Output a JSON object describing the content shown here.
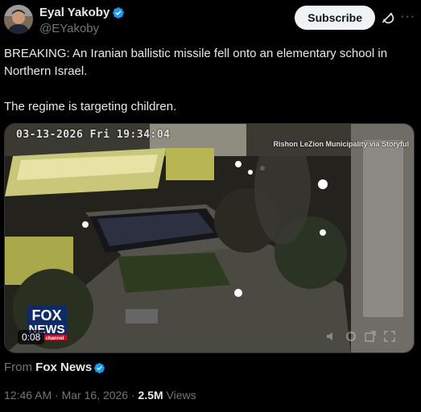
{
  "author": {
    "display_name": "Eyal Yakoby",
    "handle": "@EYakoby",
    "verified": true
  },
  "header": {
    "subscribe_label": "Subscribe",
    "grok_icon": "grok-icon",
    "more_icon": "more-dots-icon"
  },
  "tweet": {
    "line1": "BREAKING: An Iranian ballistic missile fell onto an elementary school in Northern Israel.",
    "line2": "The regime is targeting children."
  },
  "media": {
    "overlay_timestamp": "03-13-2026 Fri 19:34:04",
    "credit": "Rishon LeZion Municipality via Storyful",
    "logo_text_top": "FOX",
    "logo_text_bottom": "NEWS",
    "logo_sub": "channel",
    "duration": "0:08"
  },
  "source_line": {
    "prefix": "From",
    "source": "Fox News",
    "verified": true
  },
  "meta": {
    "time": "12:46 AM · Mar 16, 2026 · ",
    "views": "2.5M",
    "views_label": " Views"
  },
  "colors": {
    "verified_blue": "#1d9bf0",
    "background": "#000000",
    "muted_text": "#71767b"
  }
}
